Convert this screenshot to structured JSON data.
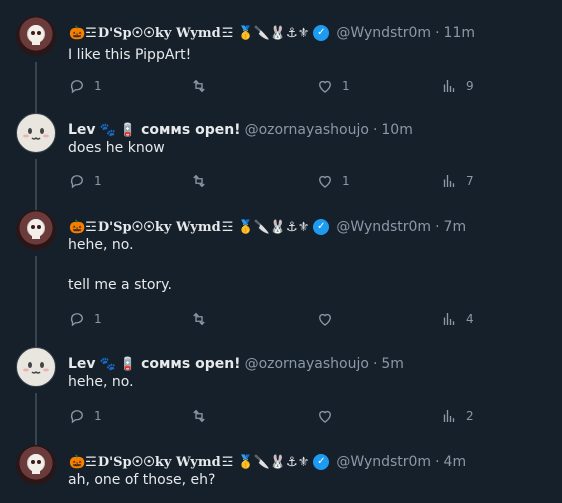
{
  "tweets": [
    {
      "name": "D'Sp☉☉ky Wymd",
      "emoji_prefix": "🎃☲",
      "emoji_suffix": "☲ 🥇🔪🐰⚓⚜",
      "handle": "@Wyndstr0m",
      "time": "11m",
      "text": "I like this PippArt!",
      "replies": "1",
      "retweets": "",
      "likes": "1",
      "views": "9"
    },
    {
      "name": "Lev",
      "emoji_suffix": "🐾 🪫",
      "name_suffix": "ᴄᴏᴍᴍѕ open!",
      "handle": "@ozornayashoujo",
      "time": "10m",
      "text": "does he know",
      "replies": "1",
      "retweets": "",
      "likes": "1",
      "views": "7"
    },
    {
      "name": "D'Sp☉☉ky Wymd",
      "emoji_prefix": "🎃☲",
      "emoji_suffix": "☲ 🥇🔪🐰⚓⚜",
      "handle": "@Wyndstr0m",
      "time": "7m",
      "text": "hehe, no.\n\ntell me a story.",
      "replies": "1",
      "retweets": "",
      "likes": "",
      "views": "4"
    },
    {
      "name": "Lev",
      "emoji_suffix": "🐾 🪫",
      "name_suffix": "ᴄᴏᴍᴍѕ open!",
      "handle": "@ozornayashoujo",
      "time": "5m",
      "text": "hehe, no.",
      "replies": "1",
      "retweets": "",
      "likes": "",
      "views": "2"
    },
    {
      "name": "D'Sp☉☉ky Wymd",
      "emoji_prefix": "🎃☲",
      "emoji_suffix": "☲ 🥇🔪🐰⚓⚜",
      "handle": "@Wyndstr0m",
      "time": "4m",
      "text": "ah, one of those, eh?"
    }
  ],
  "separator": "·",
  "verified_glyph": "✓",
  "colors": {
    "background": "#15202b",
    "text": "#e7e9ea",
    "muted": "#8b98a5",
    "verified": "#1d9bf0",
    "thread_line": "#38444d"
  },
  "icons": {
    "reply": "reply-icon",
    "retweet": "retweet-icon",
    "like": "heart-icon",
    "views": "views-icon",
    "verified": "verified-badge-icon"
  }
}
